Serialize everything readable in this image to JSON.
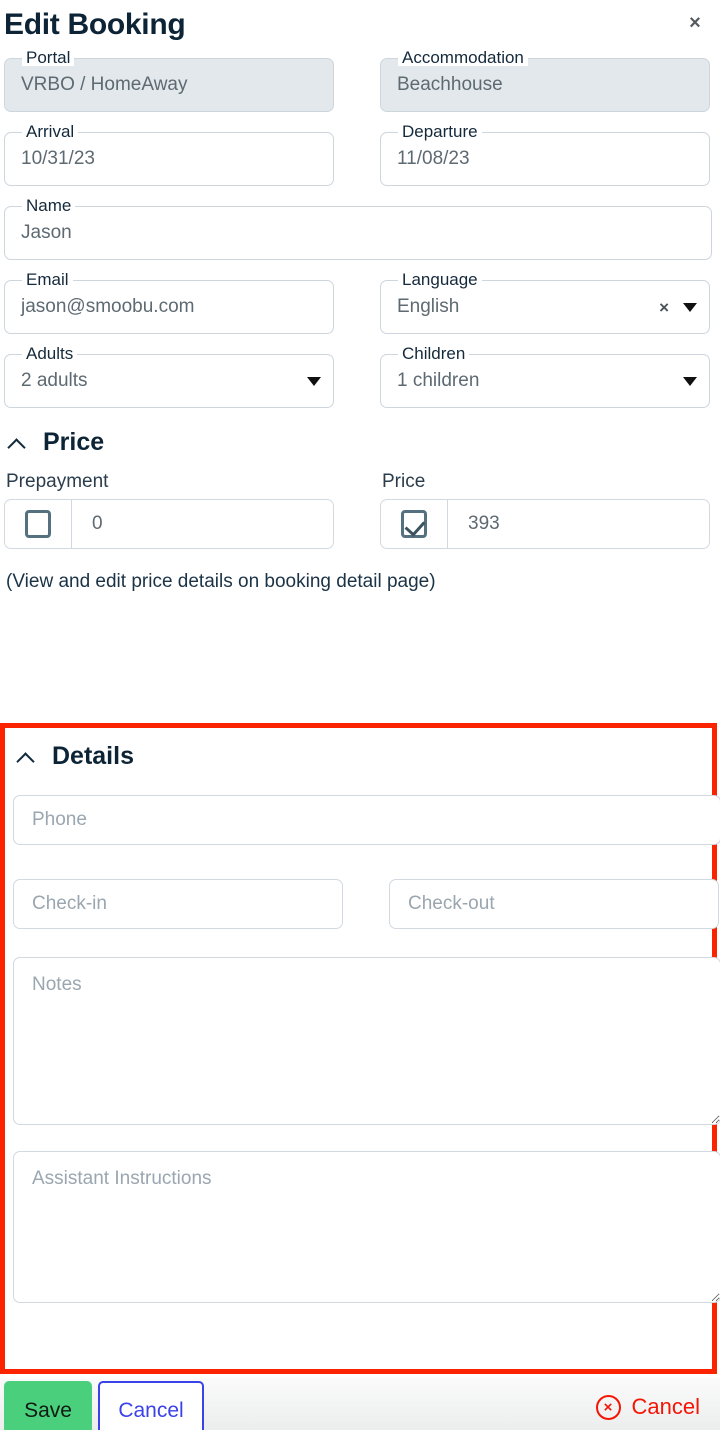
{
  "header": {
    "title": "Edit Booking",
    "close_icon": "close-icon",
    "close_label": "×"
  },
  "form": {
    "portal": {
      "label": "Portal",
      "value": "VRBO / HomeAway",
      "disabled": true
    },
    "accommodation": {
      "label": "Accommodation",
      "value": "Beachhouse",
      "disabled": true
    },
    "arrival": {
      "label": "Arrival",
      "value": "10/31/23"
    },
    "departure": {
      "label": "Departure",
      "value": "11/08/23"
    },
    "name": {
      "label": "Name",
      "value": "Jason"
    },
    "email": {
      "label": "Email",
      "value": "jason@smoobu.com"
    },
    "language": {
      "label": "Language",
      "value": "English",
      "clear_icon": "close-icon",
      "clear_label": "×",
      "dropdown_icon": "chevron-down-icon"
    },
    "adults": {
      "label": "Adults",
      "value": "2 adults",
      "dropdown_icon": "chevron-down-icon"
    },
    "children": {
      "label": "Children",
      "value": "1 children",
      "dropdown_icon": "chevron-down-icon"
    }
  },
  "price_section": {
    "title": "Price",
    "collapse_icon": "chevron-up-icon",
    "prepayment": {
      "caption": "Prepayment",
      "checked": false,
      "value": "0"
    },
    "price": {
      "caption": "Price",
      "checked": true,
      "value": "393"
    },
    "note": "(View and edit price details on booking detail page)"
  },
  "details_section": {
    "title": "Details",
    "collapse_icon": "chevron-up-icon",
    "highlight_color": "#fc2400",
    "phone": {
      "placeholder": "Phone",
      "value": ""
    },
    "check_in": {
      "placeholder": "Check-in",
      "value": ""
    },
    "check_out": {
      "placeholder": "Check-out",
      "value": ""
    },
    "notes": {
      "placeholder": "Notes",
      "value": ""
    },
    "assistant_instructions": {
      "placeholder": "Assistant Instructions",
      "value": ""
    }
  },
  "footer": {
    "save_label": "Save",
    "cancel_label": "Cancel",
    "cancel_link_label": "Cancel",
    "cancel_link_icon": "circle-x-icon",
    "cancel_link_glyph": "×",
    "save_color": "#4ad07d",
    "cancel_color": "#3b42e8",
    "cancel_link_color": "#f41505"
  }
}
